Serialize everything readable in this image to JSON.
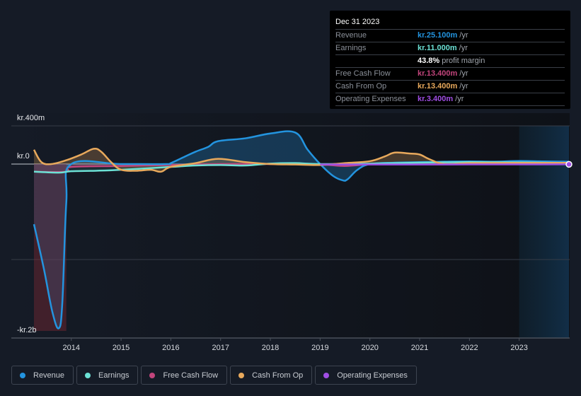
{
  "tooltip": {
    "date": "Dec 31 2023",
    "rows": [
      {
        "label": "Revenue",
        "value": "kr.25.100m",
        "unit": "/yr",
        "color": "#2394df"
      },
      {
        "label": "Earnings",
        "value": "kr.11.000m",
        "unit": "/yr",
        "color": "#6ce1d5"
      },
      {
        "label": "",
        "value": "43.8%",
        "unit": "profit margin",
        "color": "#ffffff"
      },
      {
        "label": "Free Cash Flow",
        "value": "kr.13.400m",
        "unit": "/yr",
        "color": "#c2457c"
      },
      {
        "label": "Cash From Op",
        "value": "kr.13.400m",
        "unit": "/yr",
        "color": "#e8a95c"
      },
      {
        "label": "Operating Expenses",
        "value": "kr.3.400m",
        "unit": "/yr",
        "color": "#a04ee4"
      }
    ]
  },
  "legend": [
    {
      "label": "Revenue",
      "color": "#2394df"
    },
    {
      "label": "Earnings",
      "color": "#6ce1d5"
    },
    {
      "label": "Free Cash Flow",
      "color": "#c2457c"
    },
    {
      "label": "Cash From Op",
      "color": "#e8a95c"
    },
    {
      "label": "Operating Expenses",
      "color": "#a04ee4"
    }
  ],
  "chart_data": {
    "type": "line",
    "title": "",
    "xlabel": "",
    "ylabel": "",
    "units": "kr. millions",
    "x_ticks": [
      "2014",
      "2015",
      "2016",
      "2017",
      "2018",
      "2019",
      "2020",
      "2021",
      "2022",
      "2023"
    ],
    "y_ticks": [
      {
        "value": 400,
        "label": "kr.400m"
      },
      {
        "value": 0,
        "label": "kr.0"
      },
      {
        "value": -1000,
        "label": ""
      },
      {
        "value": -1720,
        "label": "-kr.2b"
      }
    ],
    "xlim": [
      2013.25,
      2024.0
    ],
    "ylim": [
      -1800,
      400
    ],
    "forecast_region_start": 2023.0,
    "highlight_date": "Dec 31 2023",
    "series": [
      {
        "name": "Revenue",
        "color": "#2394df",
        "x": [
          2013.25,
          2013.45,
          2013.62,
          2013.75,
          2013.82,
          2013.9,
          2014.0,
          2015.0,
          2015.9,
          2016.0,
          2016.25,
          2016.5,
          2016.75,
          2016.95,
          2017.5,
          2018.0,
          2018.5,
          2018.75,
          2019.0,
          2019.25,
          2019.45,
          2019.55,
          2019.75,
          2020.0,
          2020.5,
          2021.0,
          2021.5,
          2022.0,
          2022.5,
          2023.0,
          2023.5,
          2024.0
        ],
        "values": [
          -630,
          -1100,
          -1550,
          -1720,
          -1450,
          -400,
          0,
          0,
          0,
          10,
          70,
          130,
          180,
          240,
          270,
          320,
          330,
          150,
          0,
          -120,
          -170,
          -160,
          -60,
          0,
          15,
          20,
          25,
          28,
          25,
          32,
          28,
          25
        ]
      },
      {
        "name": "Earnings",
        "color": "#6ce1d5",
        "x": [
          2013.25,
          2013.75,
          2014.0,
          2014.5,
          2015.0,
          2016.0,
          2016.5,
          2017.0,
          2017.5,
          2018.0,
          2018.5,
          2019.0,
          2020.0,
          2021.0,
          2022.0,
          2023.0,
          2024.0
        ],
        "values": [
          -80,
          -90,
          -75,
          -70,
          -60,
          -30,
          -15,
          -10,
          -15,
          5,
          10,
          0,
          5,
          15,
          20,
          18,
          11
        ]
      },
      {
        "name": "Free Cash Flow",
        "color": "#c2457c",
        "x": [
          2013.25,
          2013.9,
          2014.0,
          2015.0,
          2016.0,
          2017.0,
          2018.0,
          2019.0,
          2019.5,
          2020.0,
          2020.5,
          2021.0,
          2021.5,
          2022.0,
          2023.0,
          2024.0
        ],
        "values": [
          -80,
          -80,
          -30,
          -20,
          -10,
          0,
          0,
          -5,
          -20,
          0,
          10,
          15,
          15,
          15,
          14,
          13
        ]
      },
      {
        "name": "Cash From Op",
        "color": "#e8a95c",
        "x": [
          2013.25,
          2013.4,
          2013.6,
          2013.9,
          2014.2,
          2014.45,
          2014.6,
          2014.8,
          2015.0,
          2015.3,
          2015.6,
          2015.8,
          2016.0,
          2016.5,
          2016.95,
          2017.5,
          2018.0,
          2018.5,
          2019.0,
          2019.5,
          2020.0,
          2020.3,
          2020.5,
          2020.8,
          2021.0,
          2021.2,
          2021.5,
          2022.0,
          2023.0,
          2024.0
        ],
        "values": [
          150,
          20,
          0,
          40,
          100,
          160,
          130,
          20,
          -60,
          -70,
          -60,
          -80,
          -30,
          10,
          55,
          20,
          0,
          -5,
          -10,
          10,
          30,
          80,
          120,
          110,
          100,
          50,
          0,
          10,
          12,
          13
        ]
      },
      {
        "name": "Operating Expenses",
        "color": "#a04ee4",
        "x": [
          2019.0,
          2020.0,
          2021.0,
          2022.0,
          2023.0,
          2024.0
        ],
        "values": [
          -5,
          -5,
          -5,
          -4,
          -4,
          -3
        ]
      }
    ]
  }
}
